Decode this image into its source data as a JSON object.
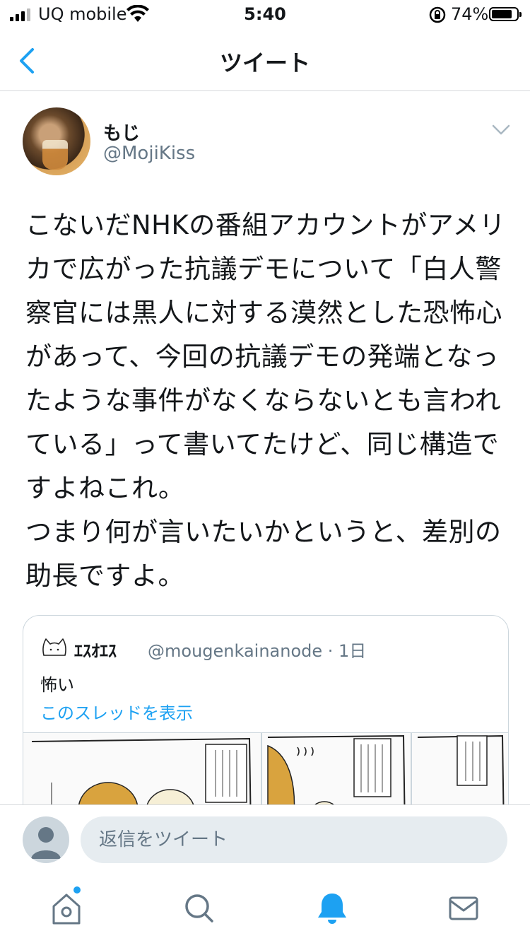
{
  "status_bar": {
    "carrier": "UQ mobile",
    "time": "5:40",
    "battery_percent": "74%"
  },
  "nav": {
    "title": "ツイート"
  },
  "tweet": {
    "display_name": "もじ",
    "handle": "@MojiKiss",
    "text": "こないだNHKの番組アカウントがアメリカで広がった抗議デモについて「白人警察官には黒人に対する漠然とした恐怖心があって、今回の抗議デモの発端となったような事件がなくならないとも言われている」って書いてたけど、同じ構造ですよねこれ。\nつまり何が言いたいかというと、差別の助長ですよ。"
  },
  "quoted_tweet": {
    "display_name": "ｴｽｵｴｽ",
    "handle_time": "@mougenkainanode · 1日",
    "text": "怖い",
    "thread_link": "このスレッドを表示"
  },
  "reply": {
    "placeholder": "返信をツイート"
  },
  "tabs": {
    "home_has_notification": true
  },
  "colors": {
    "accent": "#1da1f2",
    "text": "#14171a",
    "secondary": "#657786"
  }
}
